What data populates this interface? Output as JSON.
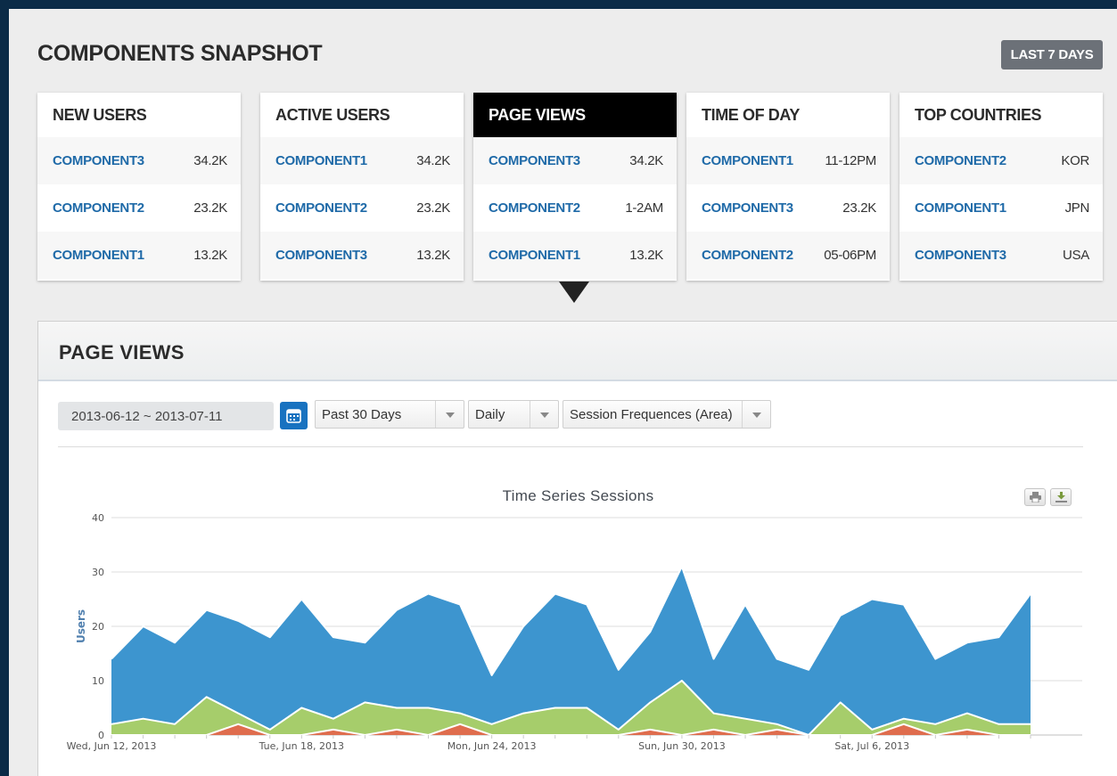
{
  "header": {
    "title": "COMPONENTS SNAPSHOT",
    "range_button": "LAST 7 DAYS"
  },
  "cards": [
    {
      "title": "NEW USERS",
      "rows": [
        {
          "name": "COMPONENT3",
          "value": "34.2K"
        },
        {
          "name": "COMPONENT2",
          "value": "23.2K"
        },
        {
          "name": "COMPONENT1",
          "value": "13.2K"
        }
      ]
    },
    {
      "title": "ACTIVE USERS",
      "rows": [
        {
          "name": "COMPONENT1",
          "value": "34.2K"
        },
        {
          "name": "COMPONENT2",
          "value": "23.2K"
        },
        {
          "name": "COMPONENT3",
          "value": "13.2K"
        }
      ]
    },
    {
      "title": "PAGE VIEWS",
      "rows": [
        {
          "name": "COMPONENT3",
          "value": "34.2K"
        },
        {
          "name": "COMPONENT2",
          "value": "1-2AM"
        },
        {
          "name": "COMPONENT1",
          "value": "13.2K"
        }
      ]
    },
    {
      "title": "TIME OF DAY",
      "rows": [
        {
          "name": "COMPONENT1",
          "value": "11-12PM"
        },
        {
          "name": "COMPONENT3",
          "value": "23.2K"
        },
        {
          "name": "COMPONENT2",
          "value": "05-06PM"
        }
      ]
    },
    {
      "title": "TOP COUNTRIES",
      "rows": [
        {
          "name": "COMPONENT2",
          "value": "KOR"
        },
        {
          "name": "COMPONENT1",
          "value": "JPN"
        },
        {
          "name": "COMPONENT3",
          "value": "USA"
        }
      ]
    }
  ],
  "panel": {
    "title": "PAGE VIEWS",
    "date_range": "2013-06-12 ~ 2013-07-11",
    "period_select": "Past 30 Days",
    "interval_select": "Daily",
    "metric_select": "Session Frequences (Area)"
  },
  "icons": {
    "calendar": "calendar-icon",
    "print": "print-icon",
    "download": "download-icon",
    "pointer": "caret-down-icon"
  },
  "colors": {
    "series_blue": "#3d95cf",
    "series_green": "#a6cd6b",
    "series_red": "#df6d4e",
    "active_card": "#000000",
    "link": "#1f6aa8"
  },
  "chart_data": {
    "type": "area",
    "title": "Time Series Sessions",
    "ylabel": "Users",
    "ylim": [
      0,
      40
    ],
    "yticks": [
      0,
      10,
      20,
      30,
      40
    ],
    "grid": true,
    "xtick_labels": [
      "Wed, Jun 12, 2013",
      "Tue, Jun 18, 2013",
      "Mon, Jun 24, 2013",
      "Sun, Jun 30, 2013",
      "Sat, Jul 6, 2013"
    ],
    "x": [
      "2013-06-12",
      "2013-06-13",
      "2013-06-14",
      "2013-06-15",
      "2013-06-16",
      "2013-06-17",
      "2013-06-18",
      "2013-06-19",
      "2013-06-20",
      "2013-06-21",
      "2013-06-22",
      "2013-06-23",
      "2013-06-24",
      "2013-06-25",
      "2013-06-26",
      "2013-06-27",
      "2013-06-28",
      "2013-06-29",
      "2013-06-30",
      "2013-07-01",
      "2013-07-02",
      "2013-07-03",
      "2013-07-04",
      "2013-07-05",
      "2013-07-06",
      "2013-07-07",
      "2013-07-08",
      "2013-07-09",
      "2013-07-10",
      "2013-07-11"
    ],
    "series": [
      {
        "color": "#3d95cf",
        "values": [
          14,
          20,
          17,
          23,
          21,
          18,
          25,
          18,
          17,
          23,
          26,
          24,
          11,
          20,
          26,
          24,
          12,
          19,
          31,
          14,
          24,
          14,
          12,
          22,
          25,
          24,
          14,
          17,
          18,
          26
        ]
      },
      {
        "color": "#a6cd6b",
        "values": [
          2,
          3,
          2,
          7,
          4,
          1,
          5,
          3,
          6,
          5,
          5,
          4,
          2,
          4,
          5,
          5,
          1,
          6,
          10,
          4,
          3,
          2,
          0,
          6,
          1,
          3,
          2,
          4,
          2,
          2
        ]
      },
      {
        "color": "#df6d4e",
        "values": [
          0,
          0,
          0,
          0,
          2,
          0,
          0,
          1,
          0,
          1,
          0,
          2,
          0,
          0,
          0,
          0,
          0,
          1,
          0,
          1,
          0,
          1,
          0,
          0,
          0,
          2,
          0,
          1,
          0,
          0
        ]
      }
    ]
  }
}
